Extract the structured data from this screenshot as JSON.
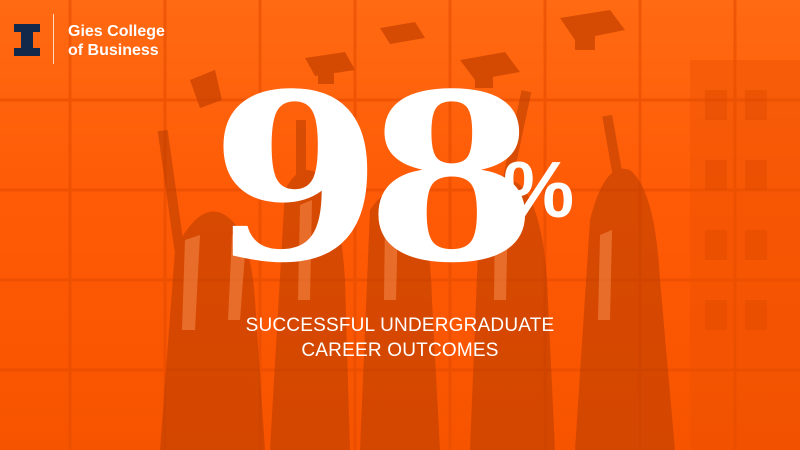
{
  "brand": {
    "line1": "Gies College",
    "line2": "of Business",
    "logo_icon": "block-i-logo-icon"
  },
  "stat": {
    "number": "98",
    "unit": "%",
    "caption_line1": "SUCCESSFUL UNDERGRADUATE",
    "caption_line2": "CAREER OUTCOMES"
  },
  "colors": {
    "accent": "#ff5f05",
    "navy": "#13294b",
    "text": "#ffffff"
  },
  "background": {
    "icon": "graduates-throwing-caps-photo"
  }
}
